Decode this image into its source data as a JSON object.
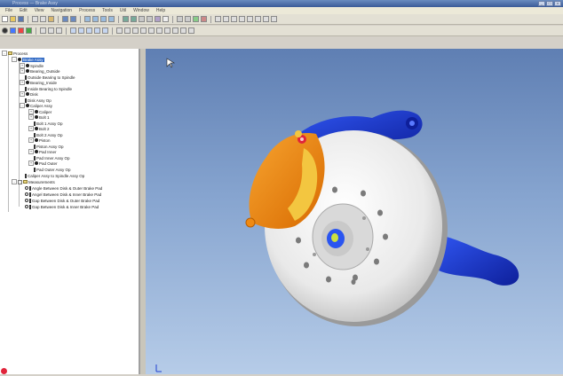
{
  "window": {
    "title": "Process — Brake Assy"
  },
  "menubar": {
    "items": [
      "File",
      "Edit",
      "View",
      "Navigation",
      "Process",
      "Tools",
      "Util",
      "Window",
      "Help"
    ]
  },
  "tree": {
    "nodes": [
      {
        "label": "Process"
      },
      {
        "label": "Brake Assy"
      },
      {
        "label": "Spindle"
      },
      {
        "label": "Bearing_Outside"
      },
      {
        "label": "Outside Bearing to Spindle"
      },
      {
        "label": "Bearing_Inside"
      },
      {
        "label": "Inside Bearing to Spindle"
      },
      {
        "label": "Disk"
      },
      {
        "label": "Disk Assy Op"
      },
      {
        "label": "Caliper Assy"
      },
      {
        "label": "Caliper"
      },
      {
        "label": "Bolt 1"
      },
      {
        "label": "Bolt 1 Assy Op"
      },
      {
        "label": "Bolt 2"
      },
      {
        "label": "Bolt 2 Assy Op"
      },
      {
        "label": "Piston"
      },
      {
        "label": "Piston Assy Op"
      },
      {
        "label": "Pad Inner"
      },
      {
        "label": "Pad Inner Assy Op"
      },
      {
        "label": "Pad Outer"
      },
      {
        "label": "Pad Outer Assy Op"
      },
      {
        "label": "Caliper Assy to Spindle Assy Op"
      },
      {
        "label": "Measurements"
      },
      {
        "label": "Angle Between Disk & Outer Brake Pad"
      },
      {
        "label": "Angel Between Disk & Inner Brake Pad"
      },
      {
        "label": "Gap Between Disk & Outer Brake Pad"
      },
      {
        "label": "Gap Between Disk & Inner Brake Pad"
      }
    ]
  },
  "colors": {
    "knuckle": "#1f3fd6",
    "caliper": "#f08a12",
    "disc": "#f4f4f4",
    "viewport_top": "#5f7fb3",
    "viewport_bottom": "#b6cce8"
  }
}
